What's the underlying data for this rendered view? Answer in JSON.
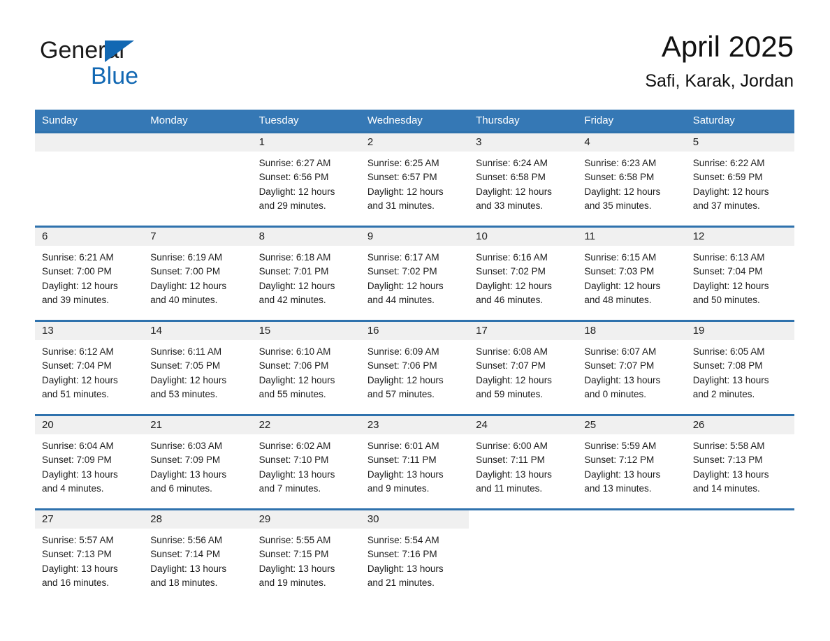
{
  "brand": {
    "name_dark": "General",
    "name_light": "Blue",
    "triangle_color": "#1268b3"
  },
  "header": {
    "month_title": "April 2025",
    "location": "Safi, Karak, Jordan"
  },
  "colors": {
    "header_blue": "#3578b5",
    "row_rule_blue": "#2f72ad",
    "date_band_gray": "#f0f0f0",
    "text": "#1c1c1c"
  },
  "calendar": {
    "weekdays": [
      "Sunday",
      "Monday",
      "Tuesday",
      "Wednesday",
      "Thursday",
      "Friday",
      "Saturday"
    ],
    "weeks": [
      [
        {
          "date": "",
          "blank": true,
          "lines": []
        },
        {
          "date": "",
          "blank": true,
          "lines": []
        },
        {
          "date": "1",
          "lines": [
            "Sunrise: 6:27 AM",
            "Sunset: 6:56 PM",
            "Daylight: 12 hours",
            "and 29 minutes."
          ]
        },
        {
          "date": "2",
          "lines": [
            "Sunrise: 6:25 AM",
            "Sunset: 6:57 PM",
            "Daylight: 12 hours",
            "and 31 minutes."
          ]
        },
        {
          "date": "3",
          "lines": [
            "Sunrise: 6:24 AM",
            "Sunset: 6:58 PM",
            "Daylight: 12 hours",
            "and 33 minutes."
          ]
        },
        {
          "date": "4",
          "lines": [
            "Sunrise: 6:23 AM",
            "Sunset: 6:58 PM",
            "Daylight: 12 hours",
            "and 35 minutes."
          ]
        },
        {
          "date": "5",
          "lines": [
            "Sunrise: 6:22 AM",
            "Sunset: 6:59 PM",
            "Daylight: 12 hours",
            "and 37 minutes."
          ]
        }
      ],
      [
        {
          "date": "6",
          "lines": [
            "Sunrise: 6:21 AM",
            "Sunset: 7:00 PM",
            "Daylight: 12 hours",
            "and 39 minutes."
          ]
        },
        {
          "date": "7",
          "lines": [
            "Sunrise: 6:19 AM",
            "Sunset: 7:00 PM",
            "Daylight: 12 hours",
            "and 40 minutes."
          ]
        },
        {
          "date": "8",
          "lines": [
            "Sunrise: 6:18 AM",
            "Sunset: 7:01 PM",
            "Daylight: 12 hours",
            "and 42 minutes."
          ]
        },
        {
          "date": "9",
          "lines": [
            "Sunrise: 6:17 AM",
            "Sunset: 7:02 PM",
            "Daylight: 12 hours",
            "and 44 minutes."
          ]
        },
        {
          "date": "10",
          "lines": [
            "Sunrise: 6:16 AM",
            "Sunset: 7:02 PM",
            "Daylight: 12 hours",
            "and 46 minutes."
          ]
        },
        {
          "date": "11",
          "lines": [
            "Sunrise: 6:15 AM",
            "Sunset: 7:03 PM",
            "Daylight: 12 hours",
            "and 48 minutes."
          ]
        },
        {
          "date": "12",
          "lines": [
            "Sunrise: 6:13 AM",
            "Sunset: 7:04 PM",
            "Daylight: 12 hours",
            "and 50 minutes."
          ]
        }
      ],
      [
        {
          "date": "13",
          "lines": [
            "Sunrise: 6:12 AM",
            "Sunset: 7:04 PM",
            "Daylight: 12 hours",
            "and 51 minutes."
          ]
        },
        {
          "date": "14",
          "lines": [
            "Sunrise: 6:11 AM",
            "Sunset: 7:05 PM",
            "Daylight: 12 hours",
            "and 53 minutes."
          ]
        },
        {
          "date": "15",
          "lines": [
            "Sunrise: 6:10 AM",
            "Sunset: 7:06 PM",
            "Daylight: 12 hours",
            "and 55 minutes."
          ]
        },
        {
          "date": "16",
          "lines": [
            "Sunrise: 6:09 AM",
            "Sunset: 7:06 PM",
            "Daylight: 12 hours",
            "and 57 minutes."
          ]
        },
        {
          "date": "17",
          "lines": [
            "Sunrise: 6:08 AM",
            "Sunset: 7:07 PM",
            "Daylight: 12 hours",
            "and 59 minutes."
          ]
        },
        {
          "date": "18",
          "lines": [
            "Sunrise: 6:07 AM",
            "Sunset: 7:07 PM",
            "Daylight: 13 hours",
            "and 0 minutes."
          ]
        },
        {
          "date": "19",
          "lines": [
            "Sunrise: 6:05 AM",
            "Sunset: 7:08 PM",
            "Daylight: 13 hours",
            "and 2 minutes."
          ]
        }
      ],
      [
        {
          "date": "20",
          "lines": [
            "Sunrise: 6:04 AM",
            "Sunset: 7:09 PM",
            "Daylight: 13 hours",
            "and 4 minutes."
          ]
        },
        {
          "date": "21",
          "lines": [
            "Sunrise: 6:03 AM",
            "Sunset: 7:09 PM",
            "Daylight: 13 hours",
            "and 6 minutes."
          ]
        },
        {
          "date": "22",
          "lines": [
            "Sunrise: 6:02 AM",
            "Sunset: 7:10 PM",
            "Daylight: 13 hours",
            "and 7 minutes."
          ]
        },
        {
          "date": "23",
          "lines": [
            "Sunrise: 6:01 AM",
            "Sunset: 7:11 PM",
            "Daylight: 13 hours",
            "and 9 minutes."
          ]
        },
        {
          "date": "24",
          "lines": [
            "Sunrise: 6:00 AM",
            "Sunset: 7:11 PM",
            "Daylight: 13 hours",
            "and 11 minutes."
          ]
        },
        {
          "date": "25",
          "lines": [
            "Sunrise: 5:59 AM",
            "Sunset: 7:12 PM",
            "Daylight: 13 hours",
            "and 13 minutes."
          ]
        },
        {
          "date": "26",
          "lines": [
            "Sunrise: 5:58 AM",
            "Sunset: 7:13 PM",
            "Daylight: 13 hours",
            "and 14 minutes."
          ]
        }
      ],
      [
        {
          "date": "27",
          "lines": [
            "Sunrise: 5:57 AM",
            "Sunset: 7:13 PM",
            "Daylight: 13 hours",
            "and 16 minutes."
          ]
        },
        {
          "date": "28",
          "lines": [
            "Sunrise: 5:56 AM",
            "Sunset: 7:14 PM",
            "Daylight: 13 hours",
            "and 18 minutes."
          ]
        },
        {
          "date": "29",
          "lines": [
            "Sunrise: 5:55 AM",
            "Sunset: 7:15 PM",
            "Daylight: 13 hours",
            "and 19 minutes."
          ]
        },
        {
          "date": "30",
          "lines": [
            "Sunrise: 5:54 AM",
            "Sunset: 7:16 PM",
            "Daylight: 13 hours",
            "and 21 minutes."
          ]
        },
        {
          "date": "",
          "empty": true,
          "lines": []
        },
        {
          "date": "",
          "empty": true,
          "lines": []
        },
        {
          "date": "",
          "empty": true,
          "lines": []
        }
      ]
    ]
  }
}
